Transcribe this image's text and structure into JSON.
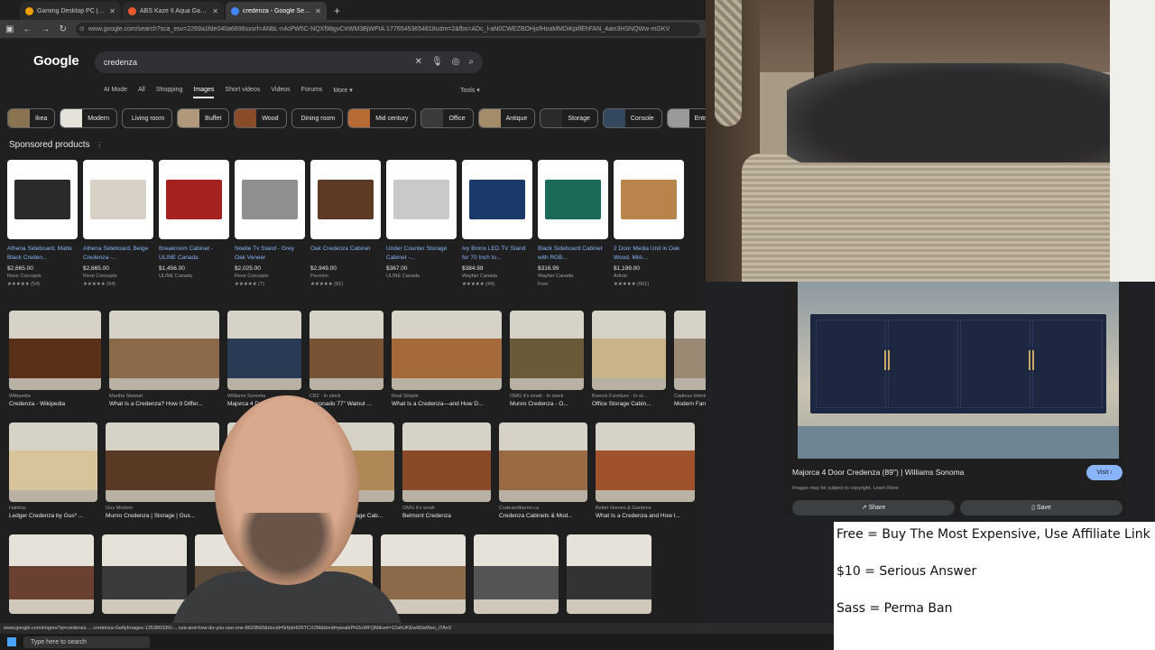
{
  "browser": {
    "tabs": [
      {
        "label": "Gaming Desktop PC | Newegg...",
        "color": "#f0a000",
        "active": false
      },
      {
        "label": "ABS Kaze II Aqua Gaming PC - ...",
        "color": "#f0a000",
        "active": false
      },
      {
        "label": "credenza - Google Search",
        "color": "#4285f4",
        "active": true
      }
    ],
    "new_tab": "+",
    "url": "www.google.com/search?sca_esv=2269a1fde040a6698sxsrf=ANbL-n4cPW5C-NQXf98gvCtrWM3BjWPIA:17765453654818udm=2&fbs=ADc_l-aN0CWEZBOHjofHoaMMDiKpiflEhFAN_4ain3HSNQWw-mGKV"
  },
  "google": {
    "logo": "Google",
    "query": "credenza",
    "nav_tabs": [
      "AI Mode",
      "All",
      "Shopping",
      "Images",
      "Short videos",
      "Videos",
      "Forums",
      "More ▾"
    ],
    "active_tab": "Images",
    "tools": "Tools ▾",
    "chips": [
      {
        "label": "Ikea",
        "img": "#8a7350"
      },
      {
        "label": "Modern",
        "img": "#e5e2dc"
      },
      {
        "label": "Living room",
        "img": ""
      },
      {
        "label": "Buffet",
        "img": "#b0987a"
      },
      {
        "label": "Wood",
        "img": "#8a4b2a"
      },
      {
        "label": "Dining room",
        "img": ""
      },
      {
        "label": "Mid century",
        "img": "#b86a33"
      },
      {
        "label": "Office",
        "img": "#3a3a3a"
      },
      {
        "label": "Antique",
        "img": "#a48c6b"
      },
      {
        "label": "Storage",
        "img": "#2a2a2a"
      },
      {
        "label": "Console",
        "img": "#34495e"
      },
      {
        "label": "Entryway",
        "img": "#9a9a9a"
      }
    ],
    "sponsored_label": "Sponsored products",
    "sponsored_info": "⋮",
    "products": [
      {
        "title": "Athena Sideboard, Matte Black Creden...",
        "price": "$2,665.00",
        "store": "Reve Concepts",
        "rating": "★★★★★ (54)",
        "color": "#2a2a2a"
      },
      {
        "title": "Athena Sideboard, Beige Credenza -...",
        "price": "$2,665.00",
        "store": "Reve Concepts",
        "rating": "★★★★★ (54)",
        "color": "#d8d2c6"
      },
      {
        "title": "Breakroom Cabinet - ULINE Canada",
        "price": "$1,456.00",
        "store": "ULINE Canada",
        "rating": "",
        "color": "#a5211f"
      },
      {
        "title": "Noelle Tv Stand - Grey Oak Veneer",
        "price": "$2,025.00",
        "store": "Reve Concepts",
        "rating": "★★★★★ (7)",
        "color": "#8f8f8f"
      },
      {
        "title": "Oak Credenza Cabinet",
        "price": "$2,949.00",
        "store": "Pevelon",
        "rating": "★★★★★ (81)",
        "color": "#5c3a24"
      },
      {
        "title": "Under Counter Storage Cabinet -...",
        "price": "$367.00",
        "store": "ULINE Canada",
        "rating": "",
        "color": "#c9c9c9"
      },
      {
        "title": "Ivy Bronx LED TV Stand for 70 Inch to...",
        "price": "$384.99",
        "store": "Wayfair Canada",
        "rating": "★★★★★ (44)",
        "color": "#1a3a6a"
      },
      {
        "title": "Black Sideboard Cabinet with RGB...",
        "price": "$316.99",
        "store": "Wayfair Canada",
        "rating": "Free",
        "color": "#1a6a5a"
      },
      {
        "title": "2 Door Media Unit in Oak Wood, Mid-...",
        "price": "$1,199.00",
        "store": "Article",
        "rating": "★★★★★ (661)",
        "color": "#b8844c"
      }
    ],
    "grid_row1": [
      {
        "src": "Wikipedia",
        "cap": "Credenza - Wikipedia",
        "color": "#5a3018",
        "w": 102
      },
      {
        "src": "Martha Stewart",
        "cap": "What Is a Credenza? How It Differ...",
        "color": "#8a6a48",
        "w": 122
      },
      {
        "src": "Williams Sonoma",
        "cap": "Majorca 4 Door Credenza",
        "color": "#2b3a55",
        "w": 82
      },
      {
        "src": "CB2 · In stock",
        "cap": "Coronado 77\" Walnut ...",
        "color": "#7a5234",
        "w": 82
      },
      {
        "src": "Real Simple",
        "cap": "What Is a Credenza—and How D...",
        "color": "#a56a3a",
        "w": 122
      },
      {
        "src": "OMG it's small · In stock",
        "cap": "Munro Credenza - O...",
        "color": "#6b5a3a",
        "w": 82
      },
      {
        "src": "Branch Furniture · In st...",
        "cap": "Office Storage Cabin...",
        "color": "#c9b48a",
        "w": 82
      },
      {
        "src": "Cadieux Interiors",
        "cap": "Modern Farmhouse Sadie Cre...",
        "color": "#9a8a74",
        "w": 108
      }
    ],
    "grid_row2": [
      {
        "src": "Habitus",
        "cap": "Ledger Credenza by Gus* ...",
        "color": "#d8c49a",
        "w": 98
      },
      {
        "src": "Gus Modern",
        "cap": "Munro Credenza | Storage | Gus...",
        "color": "#5a3a24",
        "w": 126
      },
      {
        "src": "",
        "cap": "...Gra...",
        "color": "#9a9a9a",
        "w": 80
      },
      {
        "src": "Nathan James",
        "cap": "Jasper Fluted Storage Cab...",
        "color": "#b08858",
        "w": 96
      },
      {
        "src": "OMG it's small",
        "cap": "Belmont Credenza",
        "color": "#8a4a2a",
        "w": 98
      },
      {
        "src": "Crateandbarrel.ca",
        "cap": "Credenza Cabinets & Mod...",
        "color": "#9a6a44",
        "w": 98
      },
      {
        "src": "Better Homes & Gardens",
        "cap": "What Is a Credenza and How I...",
        "color": "#a0522d",
        "w": 110
      }
    ],
    "grid_row3_colors": [
      "#6a4030",
      "#3a3a3a",
      "#5a4a3a",
      "#b59066",
      "#8a6a48",
      "#555555",
      "#333333"
    ]
  },
  "preview": {
    "title": "Majorca 4 Door Credenza (89\") | Williams Sonoma",
    "visit": "Visit ›",
    "copyright": "Images may be subject to copyright. Learn More",
    "share": "Share",
    "save": "Save"
  },
  "overlay": {
    "line1": "Free = Buy The Most Expensive, Use Affiliate Link",
    "line2": "$10 = Serious Answer",
    "line3": "Sass = Perma Ban"
  },
  "status": {
    "url": "www.google.com/imgres?q=credenza ... credenza-GettyImages-1353803391-...nza-and-how-do-you-use-one-8629569&docid=5rfpbr605TCX2M&tbnid=pwaibPhDuWFQM&vet=12ahUKEwi60aWeo_iTAxX"
  },
  "taskbar": {
    "search": "Type here to search"
  }
}
